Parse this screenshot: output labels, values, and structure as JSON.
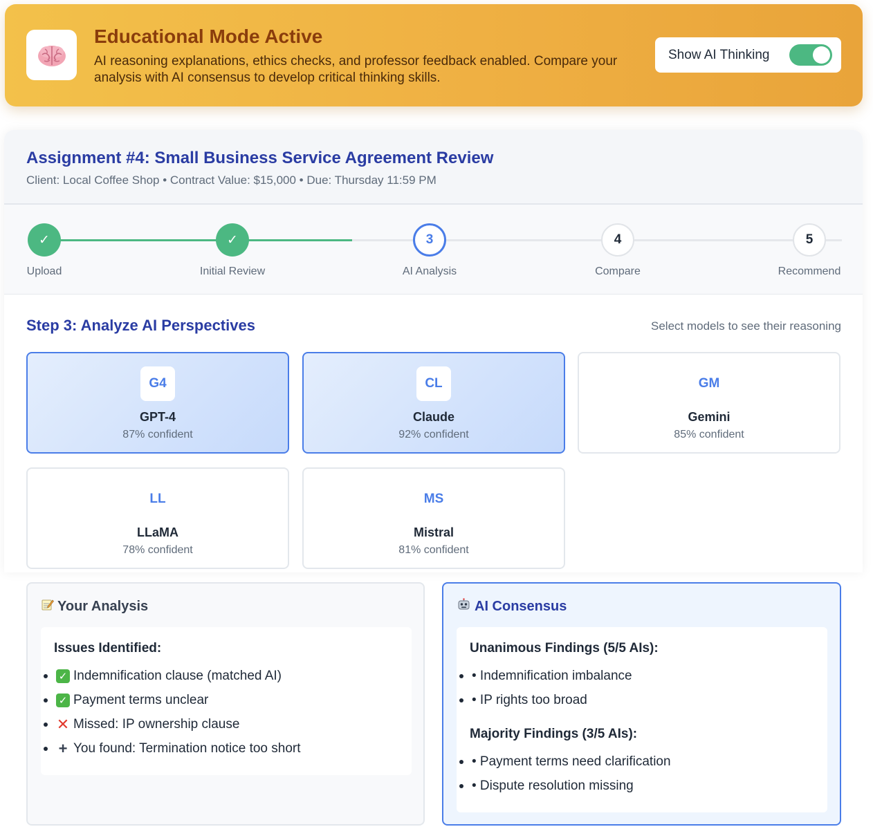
{
  "banner": {
    "title": "Educational Mode Active",
    "description": "AI reasoning explanations, ethics checks, and professor feedback enabled. Compare your analysis with AI consensus to develop critical thinking skills.",
    "icon": "brain-icon",
    "toggle_label": "Show AI Thinking",
    "toggle_on": true
  },
  "assignment": {
    "title": "Assignment #4: Small Business Service Agreement Review",
    "meta": "Client: Local Coffee Shop • Contract Value: $15,000 • Due: Thursday 11:59 PM"
  },
  "steps": [
    {
      "number": "✓",
      "label": "Upload",
      "status": "done"
    },
    {
      "number": "✓",
      "label": "Initial Review",
      "status": "done"
    },
    {
      "number": "3",
      "label": "AI Analysis",
      "status": "active"
    },
    {
      "number": "4",
      "label": "Compare",
      "status": "todo"
    },
    {
      "number": "5",
      "label": "Recommend",
      "status": "todo"
    }
  ],
  "section": {
    "title": "Step 3: Analyze AI Perspectives",
    "hint": "Select models to see their reasoning"
  },
  "models": [
    {
      "badge": "G4",
      "name": "GPT-4",
      "confidence": "87% confident",
      "selected": true
    },
    {
      "badge": "CL",
      "name": "Claude",
      "confidence": "92% confident",
      "selected": true
    },
    {
      "badge": "GM",
      "name": "Gemini",
      "confidence": "85% confident",
      "selected": false
    },
    {
      "badge": "LL",
      "name": "LLaMA",
      "confidence": "78% confident",
      "selected": false
    },
    {
      "badge": "MS",
      "name": "Mistral",
      "confidence": "81% confident",
      "selected": false
    }
  ],
  "your_analysis": {
    "title": "Your Analysis",
    "icon": "memo-icon",
    "heading": "Issues Identified:",
    "items": [
      {
        "mark": "check",
        "text": "Indemnification clause (matched AI)"
      },
      {
        "mark": "check",
        "text": "Payment terms unclear"
      },
      {
        "mark": "cross",
        "text": "Missed: IP ownership clause"
      },
      {
        "mark": "plus",
        "text": "You found: Termination notice too short"
      }
    ]
  },
  "ai_consensus": {
    "title": "AI Consensus",
    "icon": "robot-icon",
    "unanimous_heading": "Unanimous Findings (5/5 AIs):",
    "unanimous": [
      "• Indemnification imbalance",
      "• IP rights too broad"
    ],
    "majority_heading": "Majority Findings (3/5 AIs):",
    "majority": [
      "• Payment terms need clarification",
      "• Dispute resolution missing"
    ]
  },
  "colors": {
    "accent": "#4a7de8",
    "success": "#4cb882",
    "heading": "#2a3ca3",
    "banner_title": "#8a3d0c"
  }
}
